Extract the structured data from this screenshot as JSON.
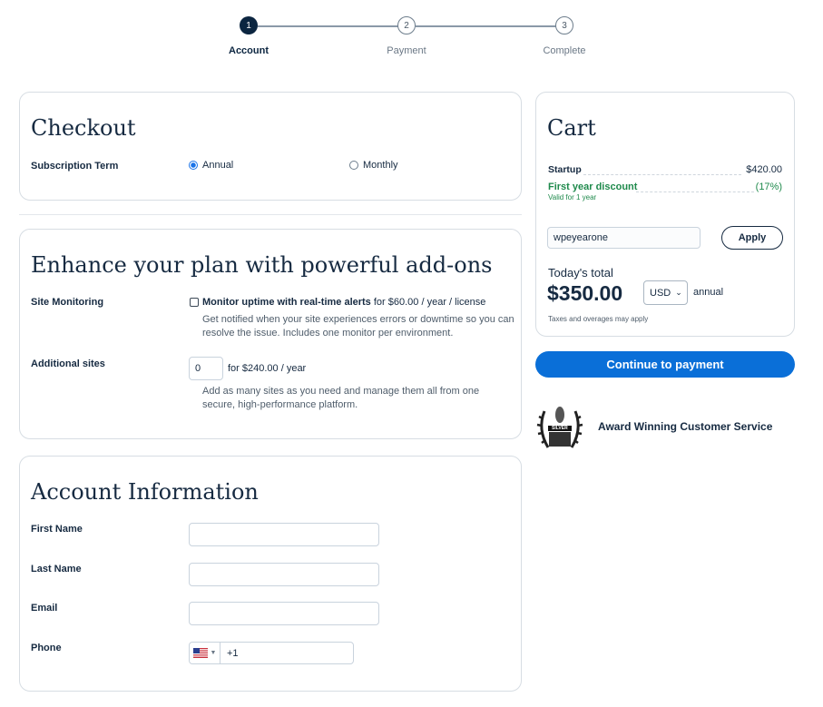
{
  "stepper": {
    "steps": [
      {
        "number": "1",
        "label": "Account"
      },
      {
        "number": "2",
        "label": "Payment"
      },
      {
        "number": "3",
        "label": "Complete"
      }
    ]
  },
  "checkout": {
    "title": "Checkout",
    "subscription_label": "Subscription Term",
    "option_annual": "Annual",
    "option_monthly": "Monthly",
    "selected": "Annual"
  },
  "addons": {
    "title": "Enhance your plan with powerful add-ons",
    "monitoring_label": "Site Monitoring",
    "monitoring_check_bold": "Monitor uptime with real-time alerts",
    "monitoring_price": "for $60.00 / year / license",
    "monitoring_desc": "Get notified when your site experiences errors or downtime so you can resolve the issue. Includes one monitor per environment.",
    "sites_label": "Additional sites",
    "sites_value": "0",
    "sites_price": "for $240.00 / year",
    "sites_desc": "Add as many sites as you need and manage them all from one secure, high-performance platform."
  },
  "account": {
    "title": "Account Information",
    "first_name": "First Name",
    "last_name": "Last Name",
    "email": "Email",
    "phone": "Phone",
    "phone_prefix": "+1"
  },
  "cart": {
    "title": "Cart",
    "item_name": "Startup",
    "item_price": "$420.00",
    "discount_name": "First year discount",
    "discount_value": "(17%)",
    "discount_note": "Valid for 1 year",
    "coupon_value": "wpeyearone",
    "apply_label": "Apply",
    "total_label": "Today's total",
    "total_value": "$350.00",
    "currency": "USD",
    "period": "annual",
    "tax_note": "Taxes and overages may apply"
  },
  "continue_label": "Continue to payment",
  "award": {
    "text": "Award Winning Customer Service",
    "badge_text": "SILVER"
  },
  "colors": {
    "primary": "#0a6fd8",
    "navy": "#0b2540",
    "discount_green": "#1f8a4c"
  }
}
